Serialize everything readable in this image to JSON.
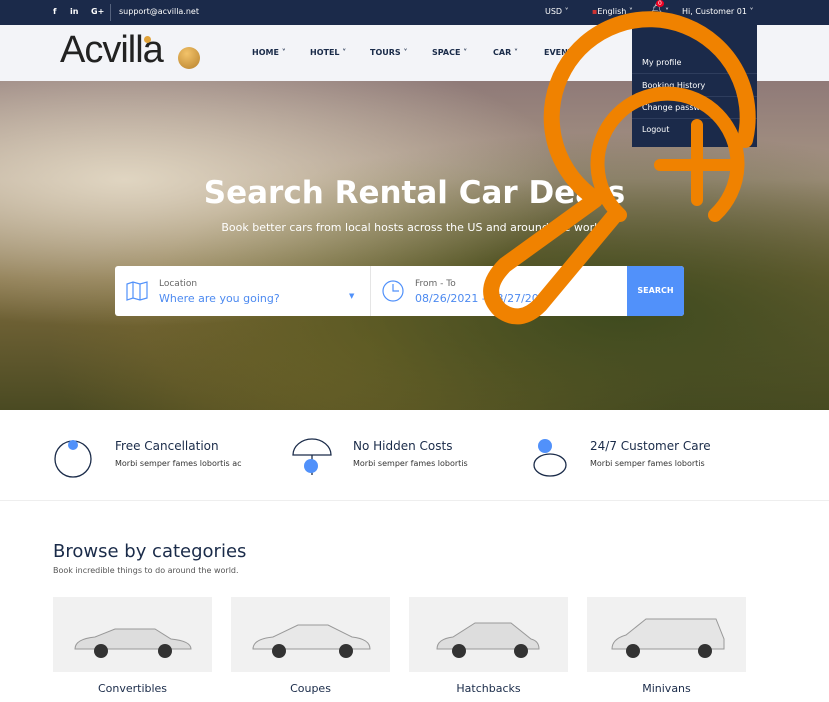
{
  "topbar": {
    "social": [
      "f",
      "in",
      "G+"
    ],
    "email": "support@acvilla.net",
    "currency": "USD",
    "language": "English",
    "notification_count": "0",
    "user": "Hi, Customer 01"
  },
  "header": {
    "logo": "Acvilla",
    "nav": [
      "HOME",
      "HOTEL",
      "TOURS",
      "SPACE",
      "CAR",
      "EVENT"
    ]
  },
  "user_menu": {
    "items": [
      "My profile",
      "Booking History",
      "Change password",
      "Logout"
    ]
  },
  "hero": {
    "title": "Search Rental Car Deals",
    "subtitle": "Book better cars from local hosts across the US and around the world.",
    "location_label": "Location",
    "location_placeholder": "Where are you going?",
    "date_label": "From - To",
    "date_value": "08/26/2021 - 08/27/2021",
    "search_button": "SEARCH"
  },
  "features": [
    {
      "title": "Free Cancellation",
      "desc": "Morbi semper fames lobortis ac"
    },
    {
      "title": "No Hidden Costs",
      "desc": "Morbi semper fames lobortis"
    },
    {
      "title": "24/7 Customer Care",
      "desc": "Morbi semper fames lobortis"
    }
  ],
  "categories": {
    "title": "Browse by categories",
    "subtitle": "Book incredible things to do around the world.",
    "items": [
      "Convertibles",
      "Coupes",
      "Hatchbacks",
      "Minivans"
    ]
  },
  "colors": {
    "navy": "#1b2a4a",
    "accent": "#5191fa",
    "overlay": "#f08200"
  }
}
